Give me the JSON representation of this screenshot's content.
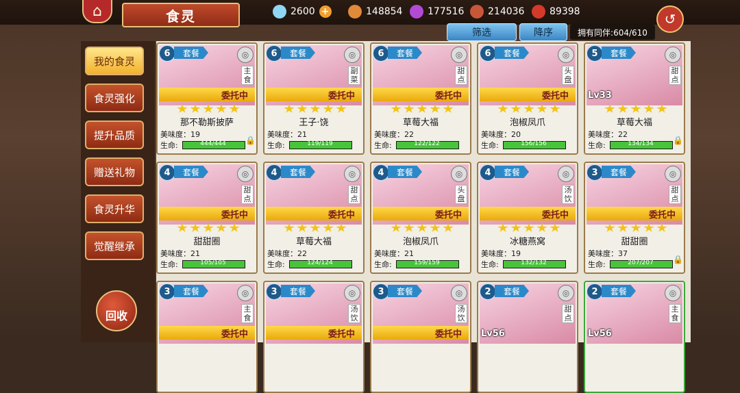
{
  "header": {
    "title": "食灵",
    "back_symbol": "↺"
  },
  "resources": [
    {
      "icon": "diamond-icon",
      "value": "2600",
      "plus": "+"
    },
    {
      "icon": "potion-icon",
      "value": "148854"
    },
    {
      "icon": "crystal-icon",
      "value": "177516"
    },
    {
      "icon": "meat-icon",
      "value": "214036"
    },
    {
      "icon": "apple-icon",
      "value": "89398"
    }
  ],
  "controls": {
    "filter": "筛选",
    "sort": "降序",
    "owned": "拥有同伴:604/610"
  },
  "sidebar": {
    "items": [
      {
        "label": "我的食灵",
        "active": true
      },
      {
        "label": "食灵强化"
      },
      {
        "label": "提升品质"
      },
      {
        "label": "赠送礼物"
      },
      {
        "label": "食灵升华"
      },
      {
        "label": "觉醒继承"
      }
    ],
    "recycle": "回收"
  },
  "cards": [
    {
      "rank": "6",
      "combo": "套餐",
      "cat": "主食",
      "dish": "plate-icon",
      "task": "委托中",
      "name": "那不勒斯披萨",
      "taste": "美味度：19",
      "hp": "444/444",
      "hp_ratio": 1.0,
      "locked": true
    },
    {
      "rank": "6",
      "combo": "套餐",
      "cat": "副菜",
      "dish": "fork-icon",
      "task": "委托中",
      "name": "王子·饶",
      "taste": "美味度：21",
      "hp": "119/119",
      "hp_ratio": 1.0
    },
    {
      "rank": "6",
      "combo": "套餐",
      "cat": "甜点",
      "dish": "cake-icon",
      "task": "委托中",
      "name": "草莓大福",
      "taste": "美味度：22",
      "hp": "122/122",
      "hp_ratio": 1.0
    },
    {
      "rank": "6",
      "combo": "套餐",
      "cat": "头盘",
      "dish": "plate-icon",
      "task": "委托中",
      "name": "泡椒凤爪",
      "taste": "美味度：20",
      "hp": "156/156",
      "hp_ratio": 1.0
    },
    {
      "rank": "5",
      "combo": "套餐",
      "cat": "甜点",
      "dish": "cake-icon",
      "level": "Lv33",
      "name": "草莓大福",
      "taste": "美味度：22",
      "hp": "134/134",
      "hp_ratio": 1.0,
      "locked": true
    },
    {
      "rank": "4",
      "combo": "套餐",
      "cat": "甜点",
      "dish": "cake-icon",
      "task": "委托中",
      "name": "甜甜圈",
      "taste": "美味度：21",
      "hp": "105/105",
      "hp_ratio": 1.0
    },
    {
      "rank": "4",
      "combo": "套餐",
      "cat": "甜点",
      "dish": "cake-icon",
      "task": "委托中",
      "name": "草莓大福",
      "taste": "美味度：22",
      "hp": "124/124",
      "hp_ratio": 1.0
    },
    {
      "rank": "4",
      "combo": "套餐",
      "cat": "头盘",
      "dish": "plate-icon",
      "task": "委托中",
      "name": "泡椒凤爪",
      "taste": "美味度：21",
      "hp": "159/159",
      "hp_ratio": 1.0
    },
    {
      "rank": "4",
      "combo": "套餐",
      "cat": "汤饮",
      "dish": "soup-icon",
      "task": "委托中",
      "name": "冰糖燕窝",
      "taste": "美味度：19",
      "hp": "132/132",
      "hp_ratio": 1.0
    },
    {
      "rank": "3",
      "combo": "套餐",
      "cat": "甜点",
      "dish": "cake-icon",
      "task": "委托中",
      "name": "甜甜圈",
      "taste": "美味度：37",
      "hp": "207/207",
      "hp_ratio": 1.0,
      "locked": true
    },
    {
      "rank": "3",
      "combo": "套餐",
      "cat": "主食",
      "dish": "plate-icon",
      "task": "委托中"
    },
    {
      "rank": "3",
      "combo": "套餐",
      "cat": "汤饮",
      "dish": "soup-icon",
      "task": "委托中"
    },
    {
      "rank": "3",
      "combo": "套餐",
      "cat": "汤饮",
      "dish": "soup-icon",
      "task": "委托中"
    },
    {
      "rank": "2",
      "combo": "套餐",
      "cat": "甜点",
      "dish": "cake-icon",
      "level": "Lv56"
    },
    {
      "rank": "2",
      "combo": "套餐",
      "cat": "主食",
      "dish": "plate-icon",
      "level": "Lv56",
      "green": true
    }
  ]
}
